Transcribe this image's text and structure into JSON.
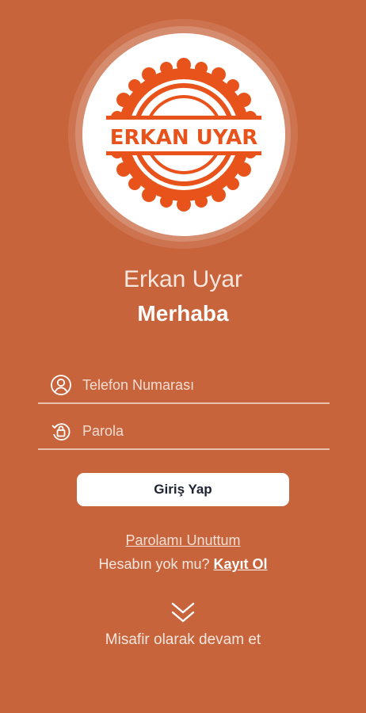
{
  "logo": {
    "text": "ERKAN UYAR",
    "accent": "#e8531c"
  },
  "brand_name": "Erkan Uyar",
  "greeting": "Merhaba",
  "form": {
    "phone_placeholder": "Telefon Numarası",
    "password_placeholder": "Parola",
    "login_label": "Giriş Yap"
  },
  "links": {
    "forgot_password": "Parolamı Unuttum",
    "no_account": "Hesabın yok mu?",
    "register": "Kayıt Ol",
    "guest": "Misafir olarak devam et"
  },
  "icons": {
    "phone_field": "user-circle-icon",
    "password_field": "lock-refresh-icon",
    "guest": "double-chevron-down-icon"
  },
  "colors": {
    "background": "#c8643c",
    "button_text": "#1e2333"
  }
}
